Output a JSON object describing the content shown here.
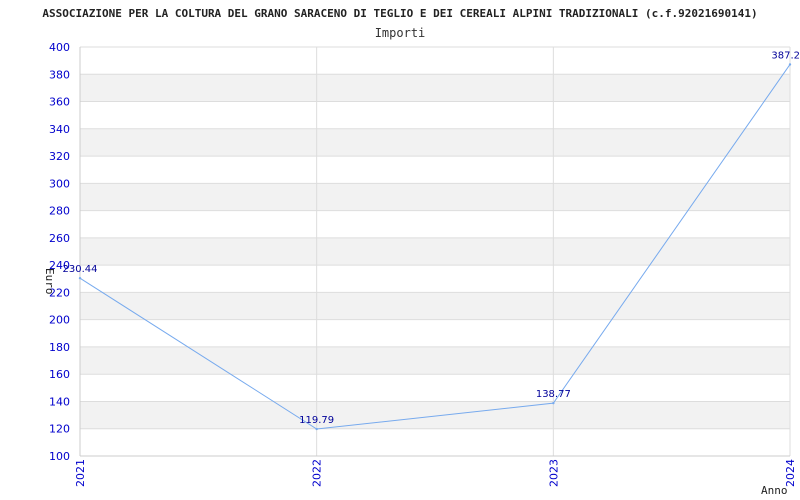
{
  "chart_data": {
    "type": "line",
    "title": "ASSOCIAZIONE PER LA COLTURA DEL GRANO SARACENO DI TEGLIO E DEI CEREALI ALPINI TRADIZIONALI (c.f.92021690141)",
    "subtitle": "Importi",
    "xlabel": "Anno",
    "ylabel": "Euro",
    "categories": [
      "2021",
      "2022",
      "2023",
      "2024"
    ],
    "series": [
      {
        "values": [
          230.44,
          119.79,
          138.77,
          387.2
        ],
        "labels": [
          "230.44",
          "119.79",
          "138.77",
          "387.2"
        ]
      }
    ],
    "ylim": [
      100,
      400
    ],
    "yticks": [
      "100",
      "120",
      "140",
      "160",
      "180",
      "200",
      "220",
      "240",
      "260",
      "280",
      "300",
      "320",
      "340",
      "360",
      "380",
      "400"
    ],
    "grid": true,
    "line_color": "#77aaee",
    "band_color": "#f2f2f2",
    "tick_color": "#0000cc"
  }
}
